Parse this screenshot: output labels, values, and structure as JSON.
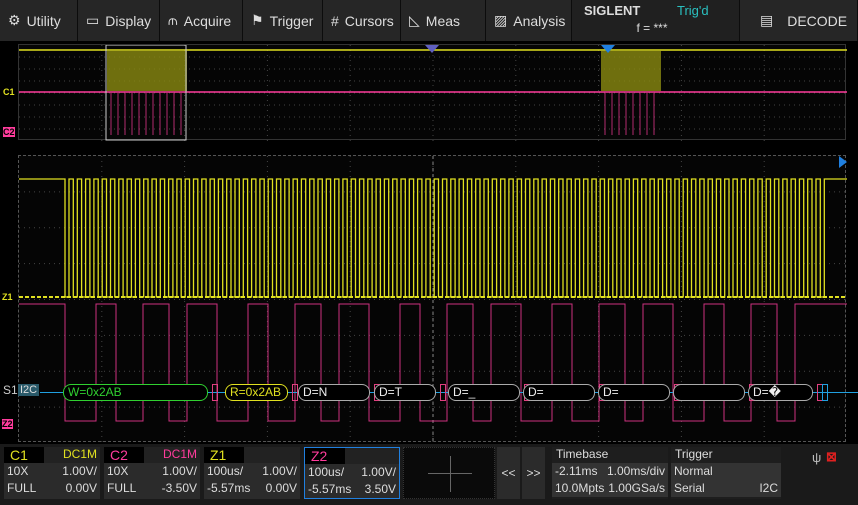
{
  "menu": [
    {
      "icon": "gear-icon",
      "label": "Utility"
    },
    {
      "icon": "monitor-icon",
      "label": "Display"
    },
    {
      "icon": "acquire-icon",
      "label": "Acquire"
    },
    {
      "icon": "flag-icon",
      "label": "Trigger"
    },
    {
      "icon": "hash-icon",
      "label": "Cursors"
    },
    {
      "icon": "ruler-icon",
      "label": "Meas"
    },
    {
      "icon": "analysis-icon",
      "label": "Analysis"
    }
  ],
  "brand": {
    "logo": "SIGLENT",
    "trigger_state": "Trig'd",
    "frequency": "f = ***"
  },
  "decode_button": {
    "icon": "decode-icon",
    "label": "DECODE"
  },
  "colors": {
    "c1": "#e0e020",
    "c2": "#ff3c9c",
    "z1": "#e0e020",
    "z2": "#ff3c9c",
    "decode_bus": "#20a0e0"
  },
  "channel_labels": {
    "overview_c1": "C1",
    "overview_c2": "C2",
    "main_z1": "Z1",
    "main_z2": "Z2",
    "serial": "S1",
    "protocol": "I2C"
  },
  "decode": [
    "W=0x2AB",
    "R=0x2AB",
    "D=N",
    "D=T",
    "D=_",
    "D=",
    "D=",
    "",
    "D=�"
  ],
  "status": {
    "c1": {
      "name": "C1",
      "coupling": "DC1M",
      "probe": "10X",
      "scale": "1.00V/",
      "bw": "FULL",
      "offset": "0.00V"
    },
    "c2": {
      "name": "C2",
      "coupling": "DC1M",
      "probe": "10X",
      "scale": "1.00V/",
      "bw": "FULL",
      "offset": "-3.50V"
    },
    "z1": {
      "name": "Z1",
      "timescale": "100us/",
      "scale": "1.00V/",
      "delay": "-5.57ms",
      "offset": "0.00V"
    },
    "z2": {
      "name": "Z2",
      "timescale": "100us/",
      "scale": "1.00V/",
      "delay": "-5.57ms",
      "offset": "3.50V"
    },
    "prev": "<<",
    "next": ">>",
    "timebase": {
      "title": "Timebase",
      "delay": "-2.11ms",
      "scale": "1.00ms/div",
      "memory": "10.0Mpts",
      "rate": "1.00GSa/s"
    },
    "trigger": {
      "title": "Trigger",
      "mode": "Normal",
      "type": "Serial",
      "source": "I2C"
    }
  }
}
